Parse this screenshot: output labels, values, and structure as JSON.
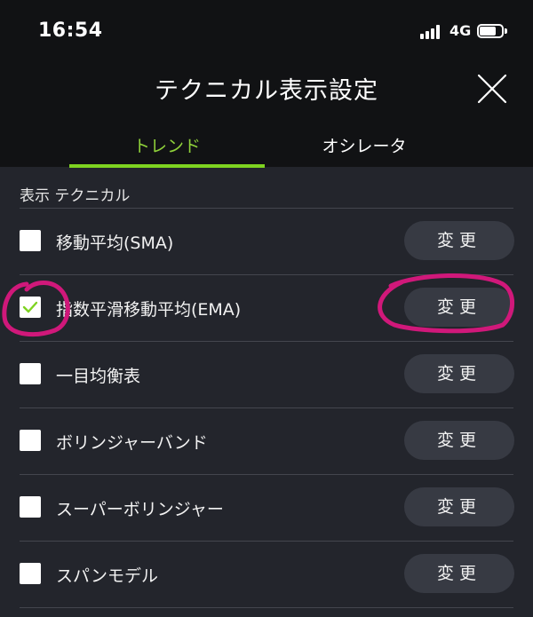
{
  "status_bar": {
    "time": "16:54",
    "network": "4G"
  },
  "header": {
    "title": "テクニカル表示設定",
    "tabs": [
      {
        "label": "トレンド",
        "active": true
      },
      {
        "label": "オシレータ",
        "active": false
      }
    ]
  },
  "section": {
    "label": "表示 テクニカル"
  },
  "rows": [
    {
      "label": "移動平均(SMA)",
      "checked": false,
      "button": "変更"
    },
    {
      "label": "指数平滑移動平均(EMA)",
      "checked": true,
      "button": "変更"
    },
    {
      "label": "一目均衡表",
      "checked": false,
      "button": "変更"
    },
    {
      "label": "ボリンジャーバンド",
      "checked": false,
      "button": "変更"
    },
    {
      "label": "スーパーボリンジャー",
      "checked": false,
      "button": "変更"
    },
    {
      "label": "スパンモデル",
      "checked": false,
      "button": "変更"
    }
  ],
  "colors": {
    "accent": "#7ed321",
    "background": "#23252c",
    "header_background": "#111214",
    "button_background": "#373a43",
    "annotation": "#d0187a"
  },
  "icons": {
    "close": "close-icon",
    "check": "checkmark-icon",
    "signal": "signal-bars-icon",
    "battery": "battery-icon"
  }
}
